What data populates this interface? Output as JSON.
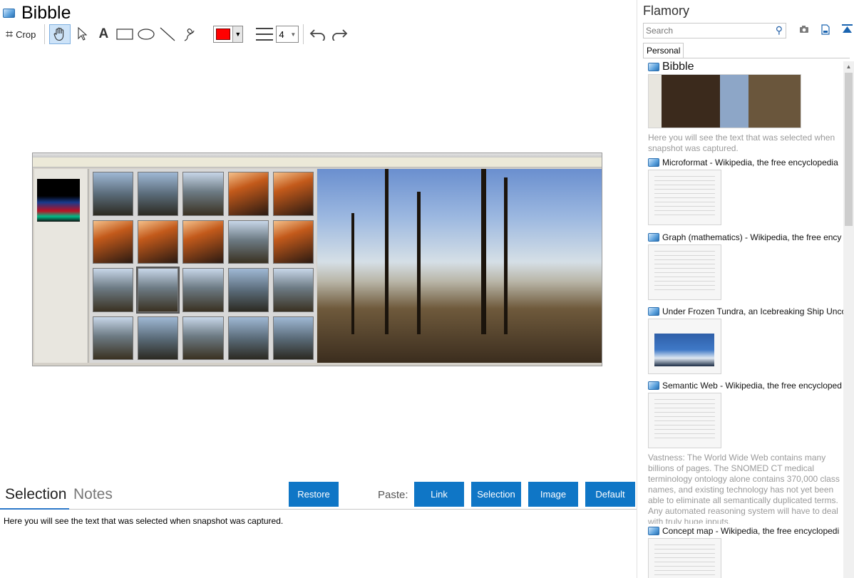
{
  "app": {
    "title": "Bibble",
    "toolbar": {
      "crop_label": "Crop",
      "line_weight_value": "4",
      "stroke_color": "#ff0000"
    }
  },
  "tabs": {
    "selection": "Selection",
    "notes": "Notes"
  },
  "actions": {
    "restore": "Restore",
    "paste_label": "Paste:",
    "link": "Link",
    "selection": "Selection",
    "image": "Image",
    "default": "Default"
  },
  "selected_text": "Here you will see the text that was selected when snapshot was captured.",
  "sidebar": {
    "brand": "Flamory",
    "search_placeholder": "Search",
    "tab": "Personal",
    "items": [
      {
        "title": "Bibble",
        "description": "Here you will see the text that was selected when snapshot was captured."
      },
      {
        "title": "Microformat - Wikipedia, the free encyclopedia"
      },
      {
        "title": "Graph (mathematics) - Wikipedia, the free ency"
      },
      {
        "title": "Under Frozen Tundra, an Icebreaking Ship Unco"
      },
      {
        "title": "Semantic Web - Wikipedia, the free encycloped",
        "description": "Vastness: The World Wide Web contains many billions of pages. The SNOMED CT medical terminology ontology alone contains 370,000 class names, and existing technology has not yet been able to eliminate all semantically duplicated terms. Any automated reasoning system will have to deal with truly huge inputs."
      },
      {
        "title": "Concept map - Wikipedia, the free encyclopedi"
      }
    ]
  },
  "colors": {
    "accent": "#0f76c6",
    "tab_underline": "#2b78c8"
  }
}
